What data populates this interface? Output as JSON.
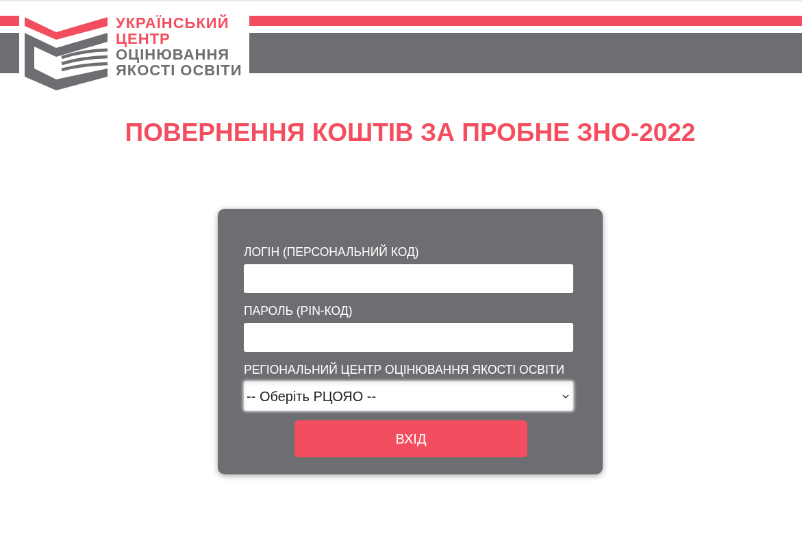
{
  "header": {
    "logo_lines": [
      {
        "text": "УКРАЇНСЬКИЙ",
        "color": "#f34e5f"
      },
      {
        "text": "ЦЕНТР",
        "color": "#f34e5f"
      },
      {
        "text": "ОЦІНЮВАННЯ",
        "color": "#6d6e71"
      },
      {
        "text": "ЯКОСТІ ОСВІТИ",
        "color": "#6d6e71"
      }
    ]
  },
  "title": "ПОВЕРНЕННЯ КОШТІВ ЗА ПРОБНЕ ЗНО-2022",
  "login_form": {
    "fields": [
      {
        "kind": "text",
        "label": "ЛОГІН (ПЕРСОНАЛЬНИЙ КОД)"
      },
      {
        "kind": "password",
        "label": "ПАРОЛЬ (PIN-КОД)"
      },
      {
        "kind": "select",
        "label": "РЕГІОНАЛЬНИЙ ЦЕНТР ОЦІНЮВАННЯ ЯКОСТІ ОСВІТИ",
        "value": "-- Оберіть РЦОЯО --"
      }
    ],
    "submit_button": "ВХІД"
  }
}
